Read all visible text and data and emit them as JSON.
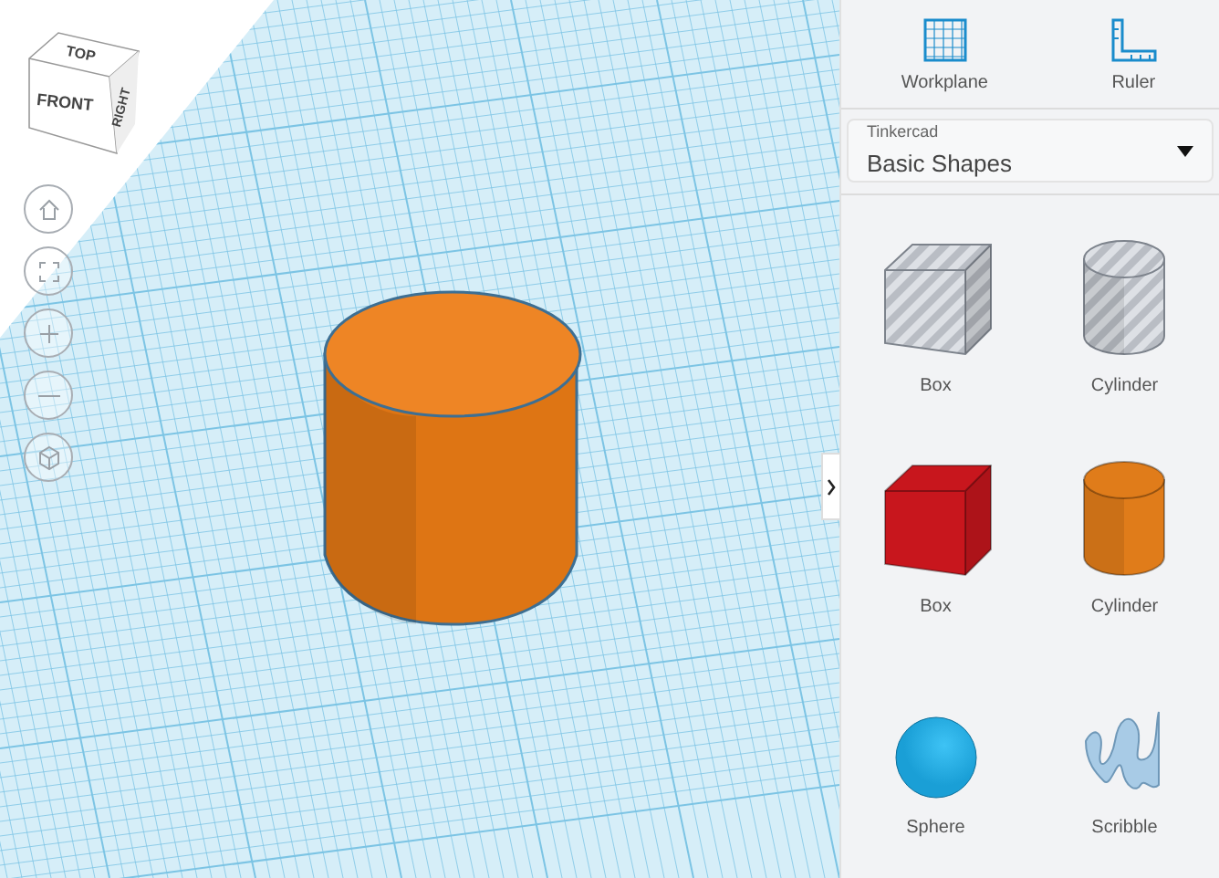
{
  "view_cube": {
    "top": "TOP",
    "front": "FRONT",
    "right": "RIGHT"
  },
  "nav_buttons": [
    {
      "kind": "home"
    },
    {
      "kind": "fit"
    },
    {
      "kind": "zoom_in"
    },
    {
      "kind": "zoom_out"
    },
    {
      "kind": "perspective"
    }
  ],
  "toolbar": [
    {
      "kind": "workplane",
      "label": "Workplane"
    },
    {
      "kind": "ruler",
      "label": "Ruler"
    }
  ],
  "library": {
    "source": "Tinkercad",
    "name": "Basic Shapes"
  },
  "shapes": [
    {
      "kind": "box",
      "label": "Box",
      "hole": true,
      "color": "#b9bdc4"
    },
    {
      "kind": "cylinder",
      "label": "Cylinder",
      "hole": true,
      "color": "#b9bdc4"
    },
    {
      "kind": "box",
      "label": "Box",
      "hole": false,
      "color": "#c8161d"
    },
    {
      "kind": "cylinder",
      "label": "Cylinder",
      "hole": false,
      "color": "#e07c1a"
    },
    {
      "kind": "sphere",
      "label": "Sphere",
      "hole": false,
      "color": "#1a9fd6"
    },
    {
      "kind": "scribble",
      "label": "Scribble",
      "hole": false,
      "color": "#a8cbe6"
    }
  ]
}
